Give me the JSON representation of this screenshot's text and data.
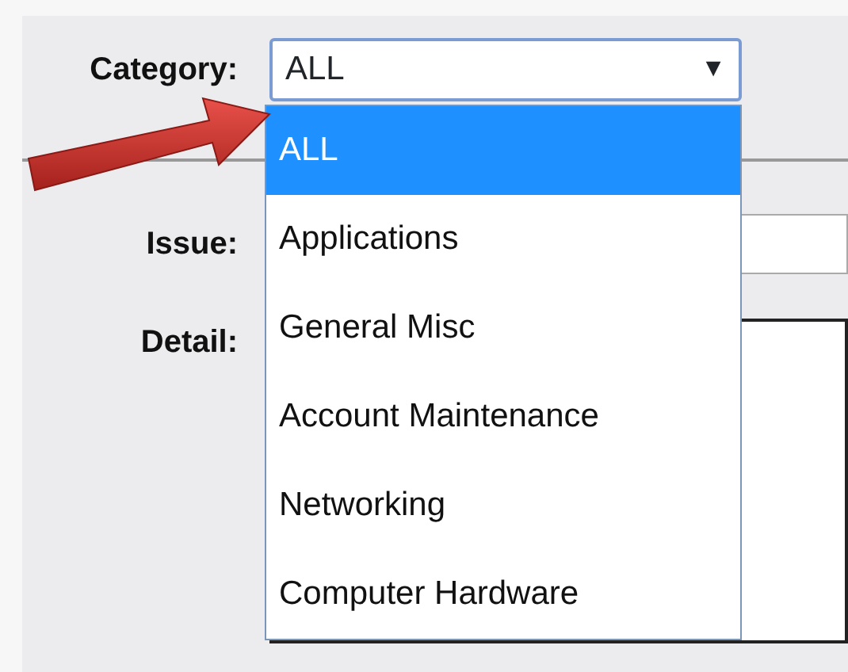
{
  "form": {
    "category": {
      "label": "Category:",
      "value": "ALL",
      "caret": "▼",
      "expanded": true,
      "options": [
        {
          "label": "ALL",
          "selected": true
        },
        {
          "label": "Applications",
          "selected": false
        },
        {
          "label": "General Misc",
          "selected": false
        },
        {
          "label": "Account Maintenance",
          "selected": false
        },
        {
          "label": "Networking",
          "selected": false
        },
        {
          "label": "Computer Hardware",
          "selected": false
        }
      ]
    },
    "issue": {
      "label": "Issue:"
    },
    "detail": {
      "label": "Detail:"
    }
  }
}
